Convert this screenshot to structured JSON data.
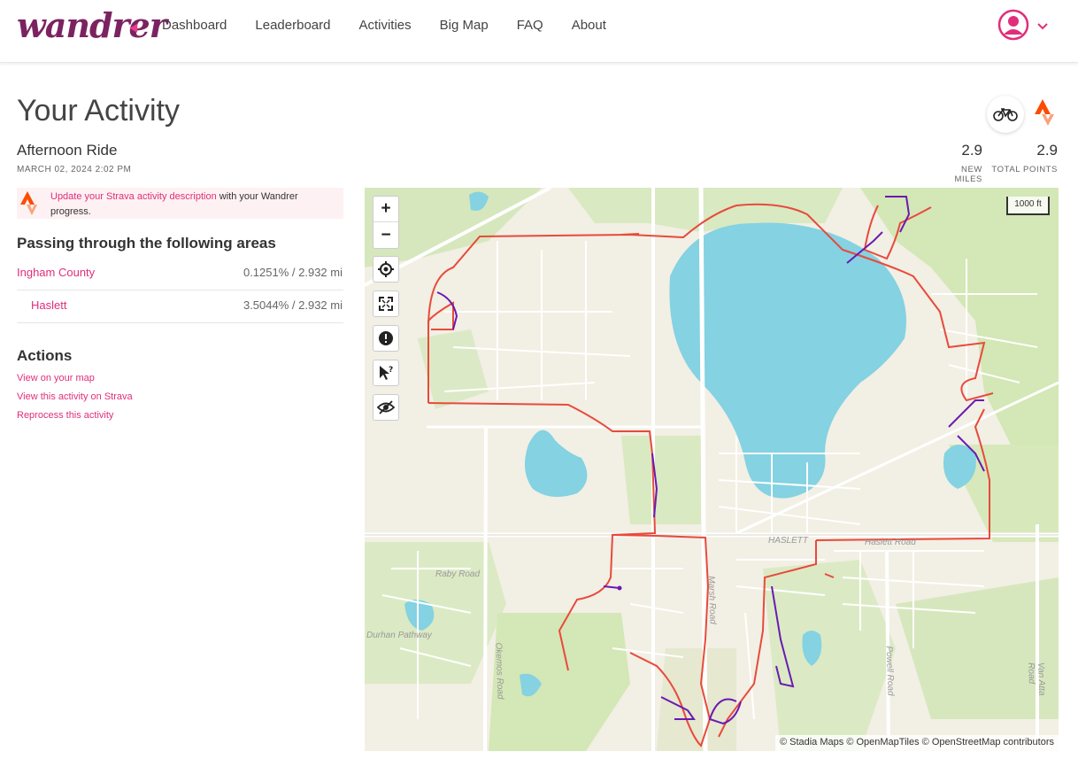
{
  "app": {
    "logo": "wandrer",
    "nav": [
      "Dashboard",
      "Leaderboard",
      "Activities",
      "Big Map",
      "FAQ",
      "About"
    ]
  },
  "page": {
    "title": "Your Activity",
    "activity_name": "Afternoon Ride",
    "activity_date": "MARCH 02, 2024 2:02 PM",
    "new_miles": "2.9",
    "new_miles_label": "NEW MILES",
    "total_points": "2.9",
    "total_points_label": "TOTAL POINTS"
  },
  "notice": {
    "link_text": "Update your Strava activity description",
    "rest_text": " with your Wandrer progress."
  },
  "areas": {
    "heading": "Passing through the following areas",
    "items": [
      {
        "name": "Ingham County",
        "value": "0.1251% / 2.932 mi"
      },
      {
        "name": "Haslett",
        "value": "3.5044% / 2.932 mi"
      }
    ]
  },
  "actions": {
    "heading": "Actions",
    "links": [
      "View on your map",
      "View this activity on Strava",
      "Reprocess this activity"
    ]
  },
  "map": {
    "scale": "1000 ft",
    "attribution": "© Stadia Maps © OpenMapTiles © OpenStreetMap contributors",
    "labels": [
      "HASLETT",
      "Haslett Road",
      "Raby Road",
      "Okemos Road",
      "Marsh Road",
      "Powell Road",
      "Van Atta Road",
      "Durhan Pathway"
    ],
    "colors": {
      "route_red": "#e84a3c",
      "route_purple": "#6a1ab2",
      "water": "#84d2e2",
      "park": "#d4e7b6",
      "accent": "#e02e7a"
    }
  }
}
